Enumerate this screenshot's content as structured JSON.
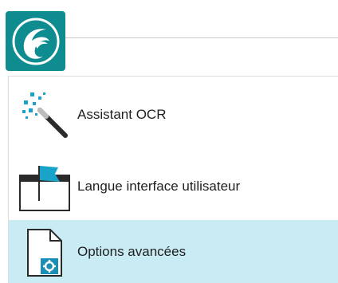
{
  "app": {
    "logo_icon": "app-logo-icon",
    "accent_color": "#0e8c90"
  },
  "menu": {
    "items": [
      {
        "label": "Assistant OCR",
        "icon": "magic-wand-icon",
        "selected": false
      },
      {
        "label": "Langue interface utilisateur",
        "icon": "flag-window-icon",
        "selected": false
      },
      {
        "label": "Options avancées",
        "icon": "gear-document-icon",
        "selected": true
      }
    ],
    "selected_color": "#c9ecf4"
  }
}
